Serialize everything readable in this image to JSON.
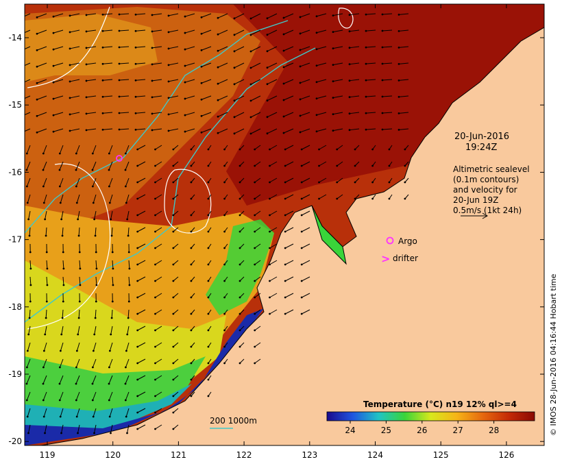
{
  "map": {
    "lon_ticks": [
      "119",
      "120",
      "121",
      "122",
      "123",
      "124",
      "125",
      "126"
    ],
    "lat_ticks": [
      "-14",
      "-15",
      "-16",
      "-17",
      "-18",
      "-19",
      "-20"
    ],
    "colors": {
      "land": "#f9c99d",
      "coast": "#000000",
      "depth_contour": "#3fc9c9",
      "sealevel_contour": "#ffffff",
      "argo": "#ff33ff",
      "drifter": "#ff33ff",
      "arrow": "#000000"
    }
  },
  "annotations": {
    "date": "20-Jun-2016",
    "time": "19:24Z",
    "legend_lines": [
      "Altimetric sealevel",
      "(0.1m contours)",
      "and velocity for",
      "20-Jun 19Z",
      "0.5m/s (1kt 24h)"
    ],
    "argo_label": "Argo",
    "drifter_label": "drifter",
    "drifter_symbol": ">",
    "depth_label": "200  1000m"
  },
  "colorbar": {
    "title": "Temperature (°C) n19 12% ql>=4",
    "ticks": [
      "24",
      "25",
      "26",
      "27",
      "28"
    ],
    "stops": [
      "#1a0a8c",
      "#1f56e0",
      "#20c4c4",
      "#3ad43a",
      "#d8e81c",
      "#f6b417",
      "#e6680f",
      "#c42a06",
      "#8a0a04"
    ]
  },
  "credit": "© IMOS 28-Jun-2016 04:16:44 Hobart time"
}
